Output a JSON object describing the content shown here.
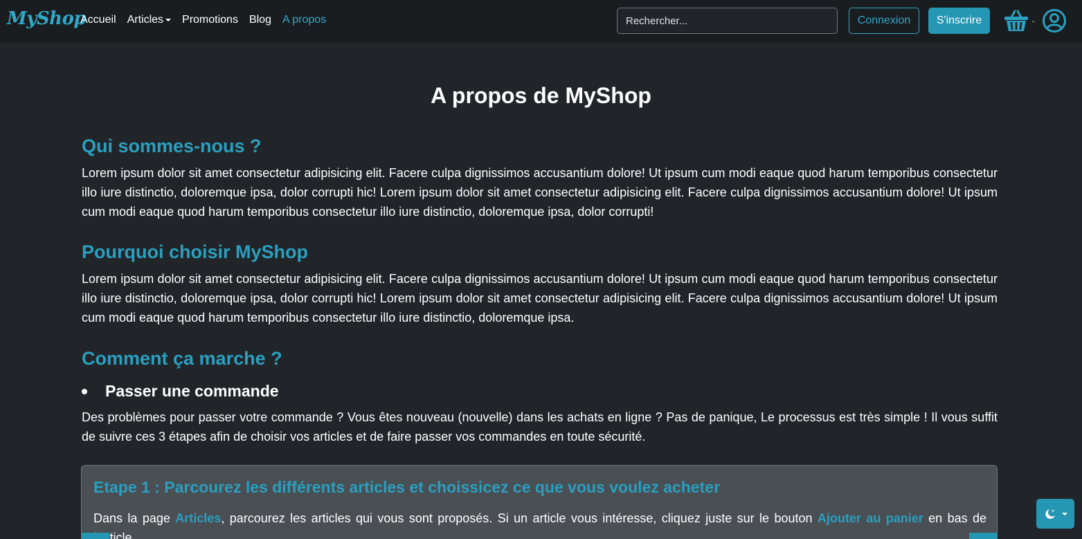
{
  "navbar": {
    "brand": "MyShop",
    "links": [
      {
        "label": "Accueil"
      },
      {
        "label": "Articles"
      },
      {
        "label": "Promotions"
      },
      {
        "label": "Blog"
      },
      {
        "label": "A propos"
      }
    ],
    "active_link": "A propos",
    "search_placeholder": "Rechercher...",
    "login_label": "Connexion",
    "signup_label": "S'inscrire",
    "cart_count": "-",
    "cart_icon": "basket-icon",
    "user_icon": "user-circle-icon"
  },
  "page": {
    "title": "A propos de MyShop",
    "sections": [
      {
        "heading": "Qui sommes-nous ?",
        "text": "Lorem ipsum dolor sit amet consectetur adipisicing elit. Facere culpa dignissimos accusantium dolore! Ut ipsum cum modi eaque quod harum temporibus consectetur illo iure distinctio, doloremque ipsa, dolor corrupti hic! Lorem ipsum dolor sit amet consectetur adipisicing elit. Facere culpa dignissimos accusantium dolore! Ut ipsum cum modi eaque quod harum temporibus consectetur illo iure distinctio, doloremque ipsa, dolor corrupti!"
      },
      {
        "heading": "Pourquoi choisir MyShop",
        "text": "Lorem ipsum dolor sit amet consectetur adipisicing elit. Facere culpa dignissimos accusantium dolore! Ut ipsum cum modi eaque quod harum temporibus consectetur illo iure distinctio, doloremque ipsa, dolor corrupti hic! Lorem ipsum dolor sit amet consectetur adipisicing elit. Facere culpa dignissimos accusantium dolore! Ut ipsum cum modi eaque quod harum temporibus consectetur illo iure distinctio, doloremque ipsa."
      },
      {
        "heading": "Comment ça marche ?"
      }
    ],
    "bullet": "Passer une commande",
    "bullet_text": "Des problèmes pour passer votre commande ? Vous êtes nouveau (nouvelle) dans les achats en ligne ? Pas de panique, Le processus est très simple ! Il vous suffit de suivre ces 3 étapes afin de choisir vos articles et de faire passer vos commandes en toute sécurité.",
    "step1": {
      "title": "Etape 1 : Parcourez les différents articles et choissicez ce que vous voulez acheter",
      "text_before": "Dans la page ",
      "link1": "Articles",
      "text_middle": ", parcourez les articles qui vous sont proposés. Si un article vous intéresse, cliquez juste sur le bouton ",
      "link2": "Ajouter au panier",
      "text_after": " en bas de l'article."
    }
  },
  "theme_toggle_icon": "moon-stars-icon",
  "colors": {
    "accent": "#2a9fbf",
    "background": "#212529",
    "navbar": "#1a1d20",
    "card": "#4a4f54"
  }
}
